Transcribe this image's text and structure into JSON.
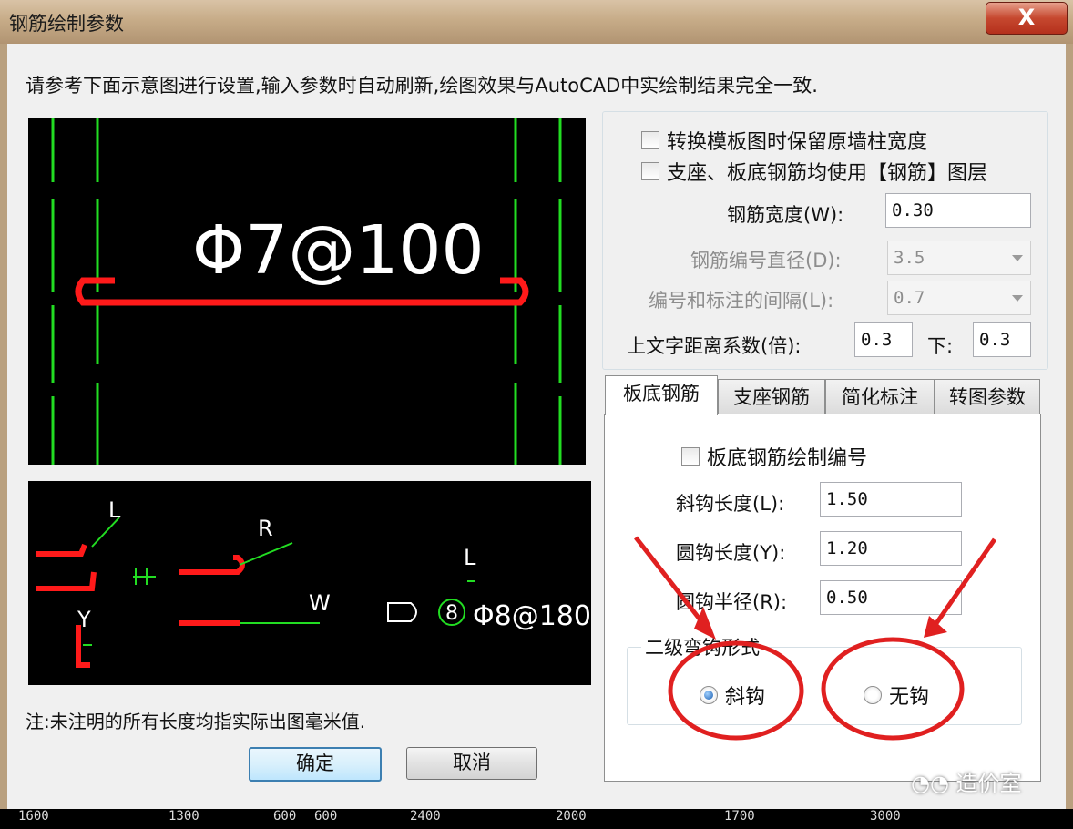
{
  "window": {
    "title": "钢筋绘制参数",
    "close_label": "X"
  },
  "intro_text": "请参考下面示意图进行设置,输入参数时自动刷新,绘图效果与AutoCAD中实绘制结果完全一致.",
  "preview_top": {
    "rebar_label": "Φ7@100"
  },
  "preview_bottom": {
    "label_L1": "L",
    "label_Y": "Y",
    "label_R": "R",
    "label_W": "W",
    "label_L2": "L",
    "num_label": "8",
    "rebar_label": "Φ8@180"
  },
  "note": "注:未注明的所有长度均指实际出图毫米值.",
  "buttons": {
    "ok": "确定",
    "cancel": "取消"
  },
  "options": {
    "keep_wall_width": {
      "label": "转换模板图时保留原墙柱宽度",
      "checked": false
    },
    "use_rebar_layer": {
      "label": "支座、板底钢筋均使用【钢筋】图层",
      "checked": false
    }
  },
  "fields": {
    "rebar_width": {
      "label": "钢筋宽度(W):",
      "value": "0.30"
    },
    "number_diameter": {
      "label": "钢筋编号直径(D):",
      "value": "3.5",
      "disabled": true
    },
    "label_spacing": {
      "label": "编号和标注的间隔(L):",
      "value": "0.7",
      "disabled": true
    },
    "text_distance": {
      "label": "上文字距离系数(倍):",
      "value": "0.3",
      "below_label": "下:",
      "below_value": "0.3"
    }
  },
  "tabs": [
    "板底钢筋",
    "支座钢筋",
    "简化标注",
    "转图参数"
  ],
  "active_tab": "板底钢筋",
  "bottom_panel": {
    "draw_number": {
      "label": "板底钢筋绘制编号",
      "checked": false
    },
    "hook_length": {
      "label": "斜钩长度(L):",
      "value": "1.50"
    },
    "round_hook_length": {
      "label": "圆钩长度(Y):",
      "value": "1.20"
    },
    "round_hook_radius": {
      "label": "圆钩半径(R):",
      "value": "0.50"
    },
    "secondary_hook": {
      "title": "二级弯钩形式",
      "options": [
        {
          "label": "斜钩",
          "selected": true
        },
        {
          "label": "无钩",
          "selected": false
        }
      ]
    }
  },
  "ruler": [
    "1600",
    "1300",
    "600",
    "600",
    "2400",
    "2000",
    "1700",
    "3000"
  ],
  "watermark": "造价室",
  "colors": {
    "annotation": "#e02020",
    "rebar": "#ff1a1a",
    "guide": "#22dd22"
  }
}
